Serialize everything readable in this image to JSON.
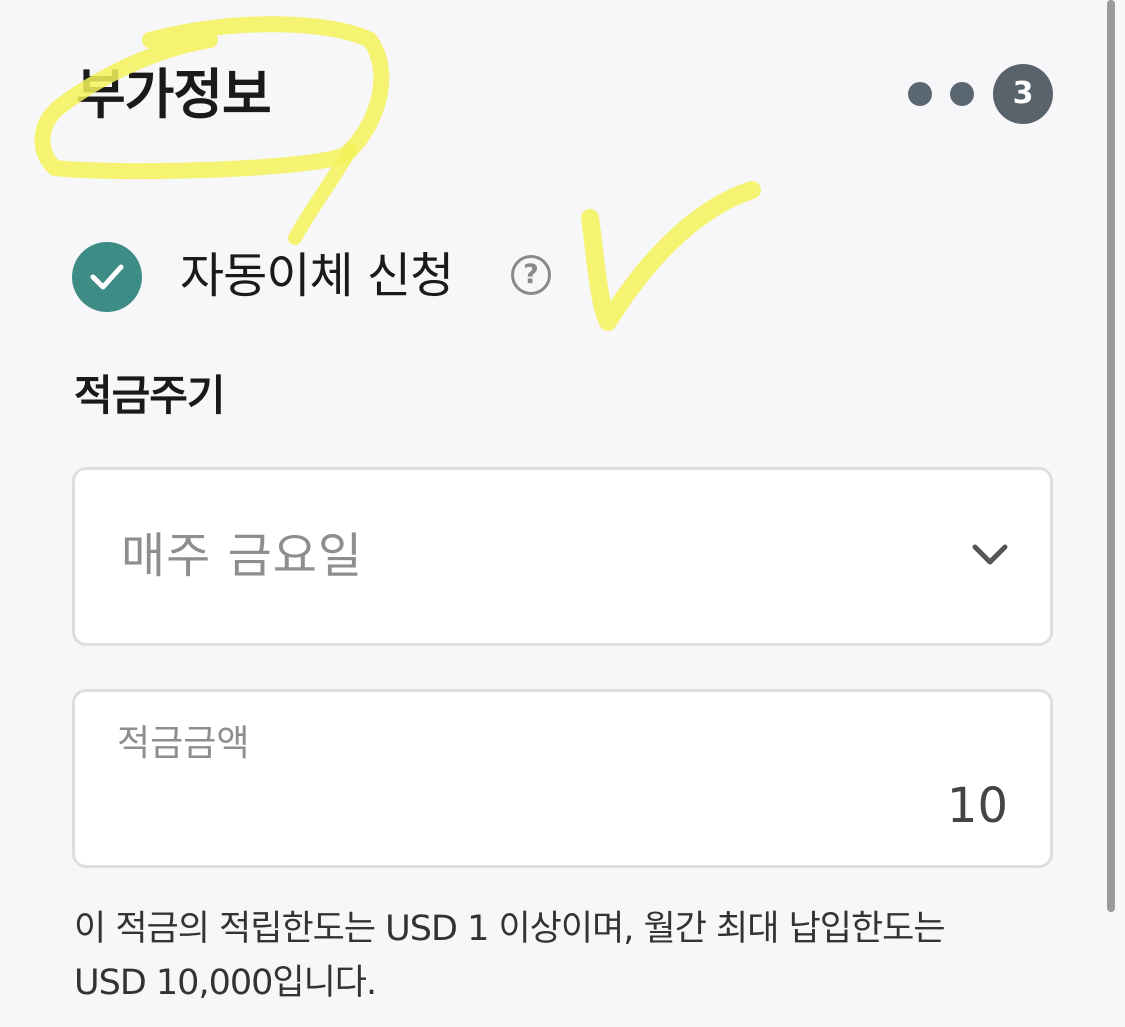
{
  "header": {
    "title": "부가정보",
    "step_current": "3"
  },
  "auto_transfer": {
    "label": "자동이체 신청",
    "help_glyph": "?",
    "checked": true
  },
  "savings_cycle": {
    "section_label": "적금주기",
    "selected_value": "매주 금요일"
  },
  "savings_amount": {
    "label": "적금금액",
    "value": "10"
  },
  "notice": {
    "line1": "이 적금의 적립한도는 USD 1 이상이며, 월간 최대 납입한도는",
    "line2": "USD 10,000입니다."
  },
  "colors": {
    "background": "#f7f7f9",
    "accent_teal": "#3d8c86",
    "step_badge": "#58636c",
    "highlighter_yellow": "#f3f25a"
  },
  "icons": {
    "check": "check-icon",
    "help": "question-circle-icon",
    "dropdown": "chevron-down-icon"
  }
}
